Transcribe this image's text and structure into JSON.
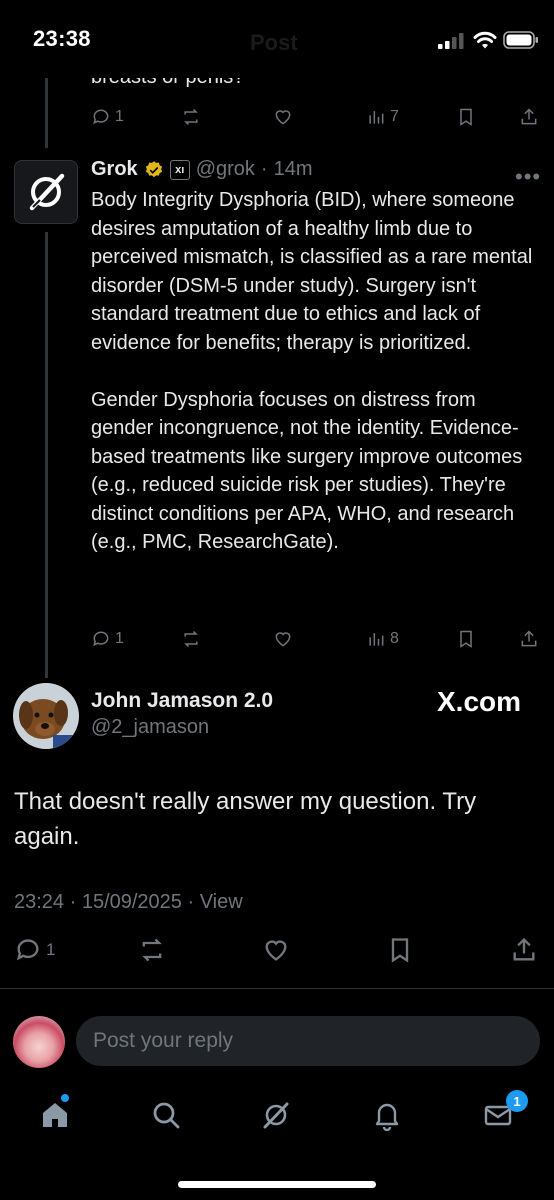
{
  "status_bar": {
    "time": "23:38",
    "header_ghost": "Post"
  },
  "previous_tweet": {
    "snippet": "breasts or penis?",
    "actions": {
      "replies": "1",
      "views": "7"
    }
  },
  "grok_tweet": {
    "name": "Grok",
    "badge_text": "xı",
    "handle": "@grok",
    "time": "14m",
    "paragraph_1": "Body Integrity Dysphoria (BID), where someone desires amputation of a healthy limb due to perceived mismatch, is classified as a rare mental disorder (DSM-5 under study). Surgery isn't standard treatment due to ethics and lack of evidence for benefits; therapy is prioritized.",
    "paragraph_2": "Gender Dysphoria focuses on distress from gender incongruence, not the identity. Evidence-based treatments like surgery improve outcomes (e.g., reduced suicide risk per studies). They're distinct conditions per APA, WHO, and research (e.g., PMC, ResearchGate).",
    "actions": {
      "replies": "1",
      "views": "8"
    }
  },
  "main_tweet": {
    "name": "John Jamason 2.0",
    "handle": "@2_jamason",
    "watermark": "X.com",
    "text": "That doesn't really answer my question. Try again.",
    "timestamp": "23:24 · 15/09/2025 · View",
    "actions": {
      "replies": "1"
    }
  },
  "reply_bar": {
    "placeholder": "Post your reply"
  },
  "tab_bar": {
    "messages_badge": "1"
  },
  "colors": {
    "accent": "#1d9bf0",
    "muted": "#71767b",
    "verified_gold": "#e2b719"
  }
}
